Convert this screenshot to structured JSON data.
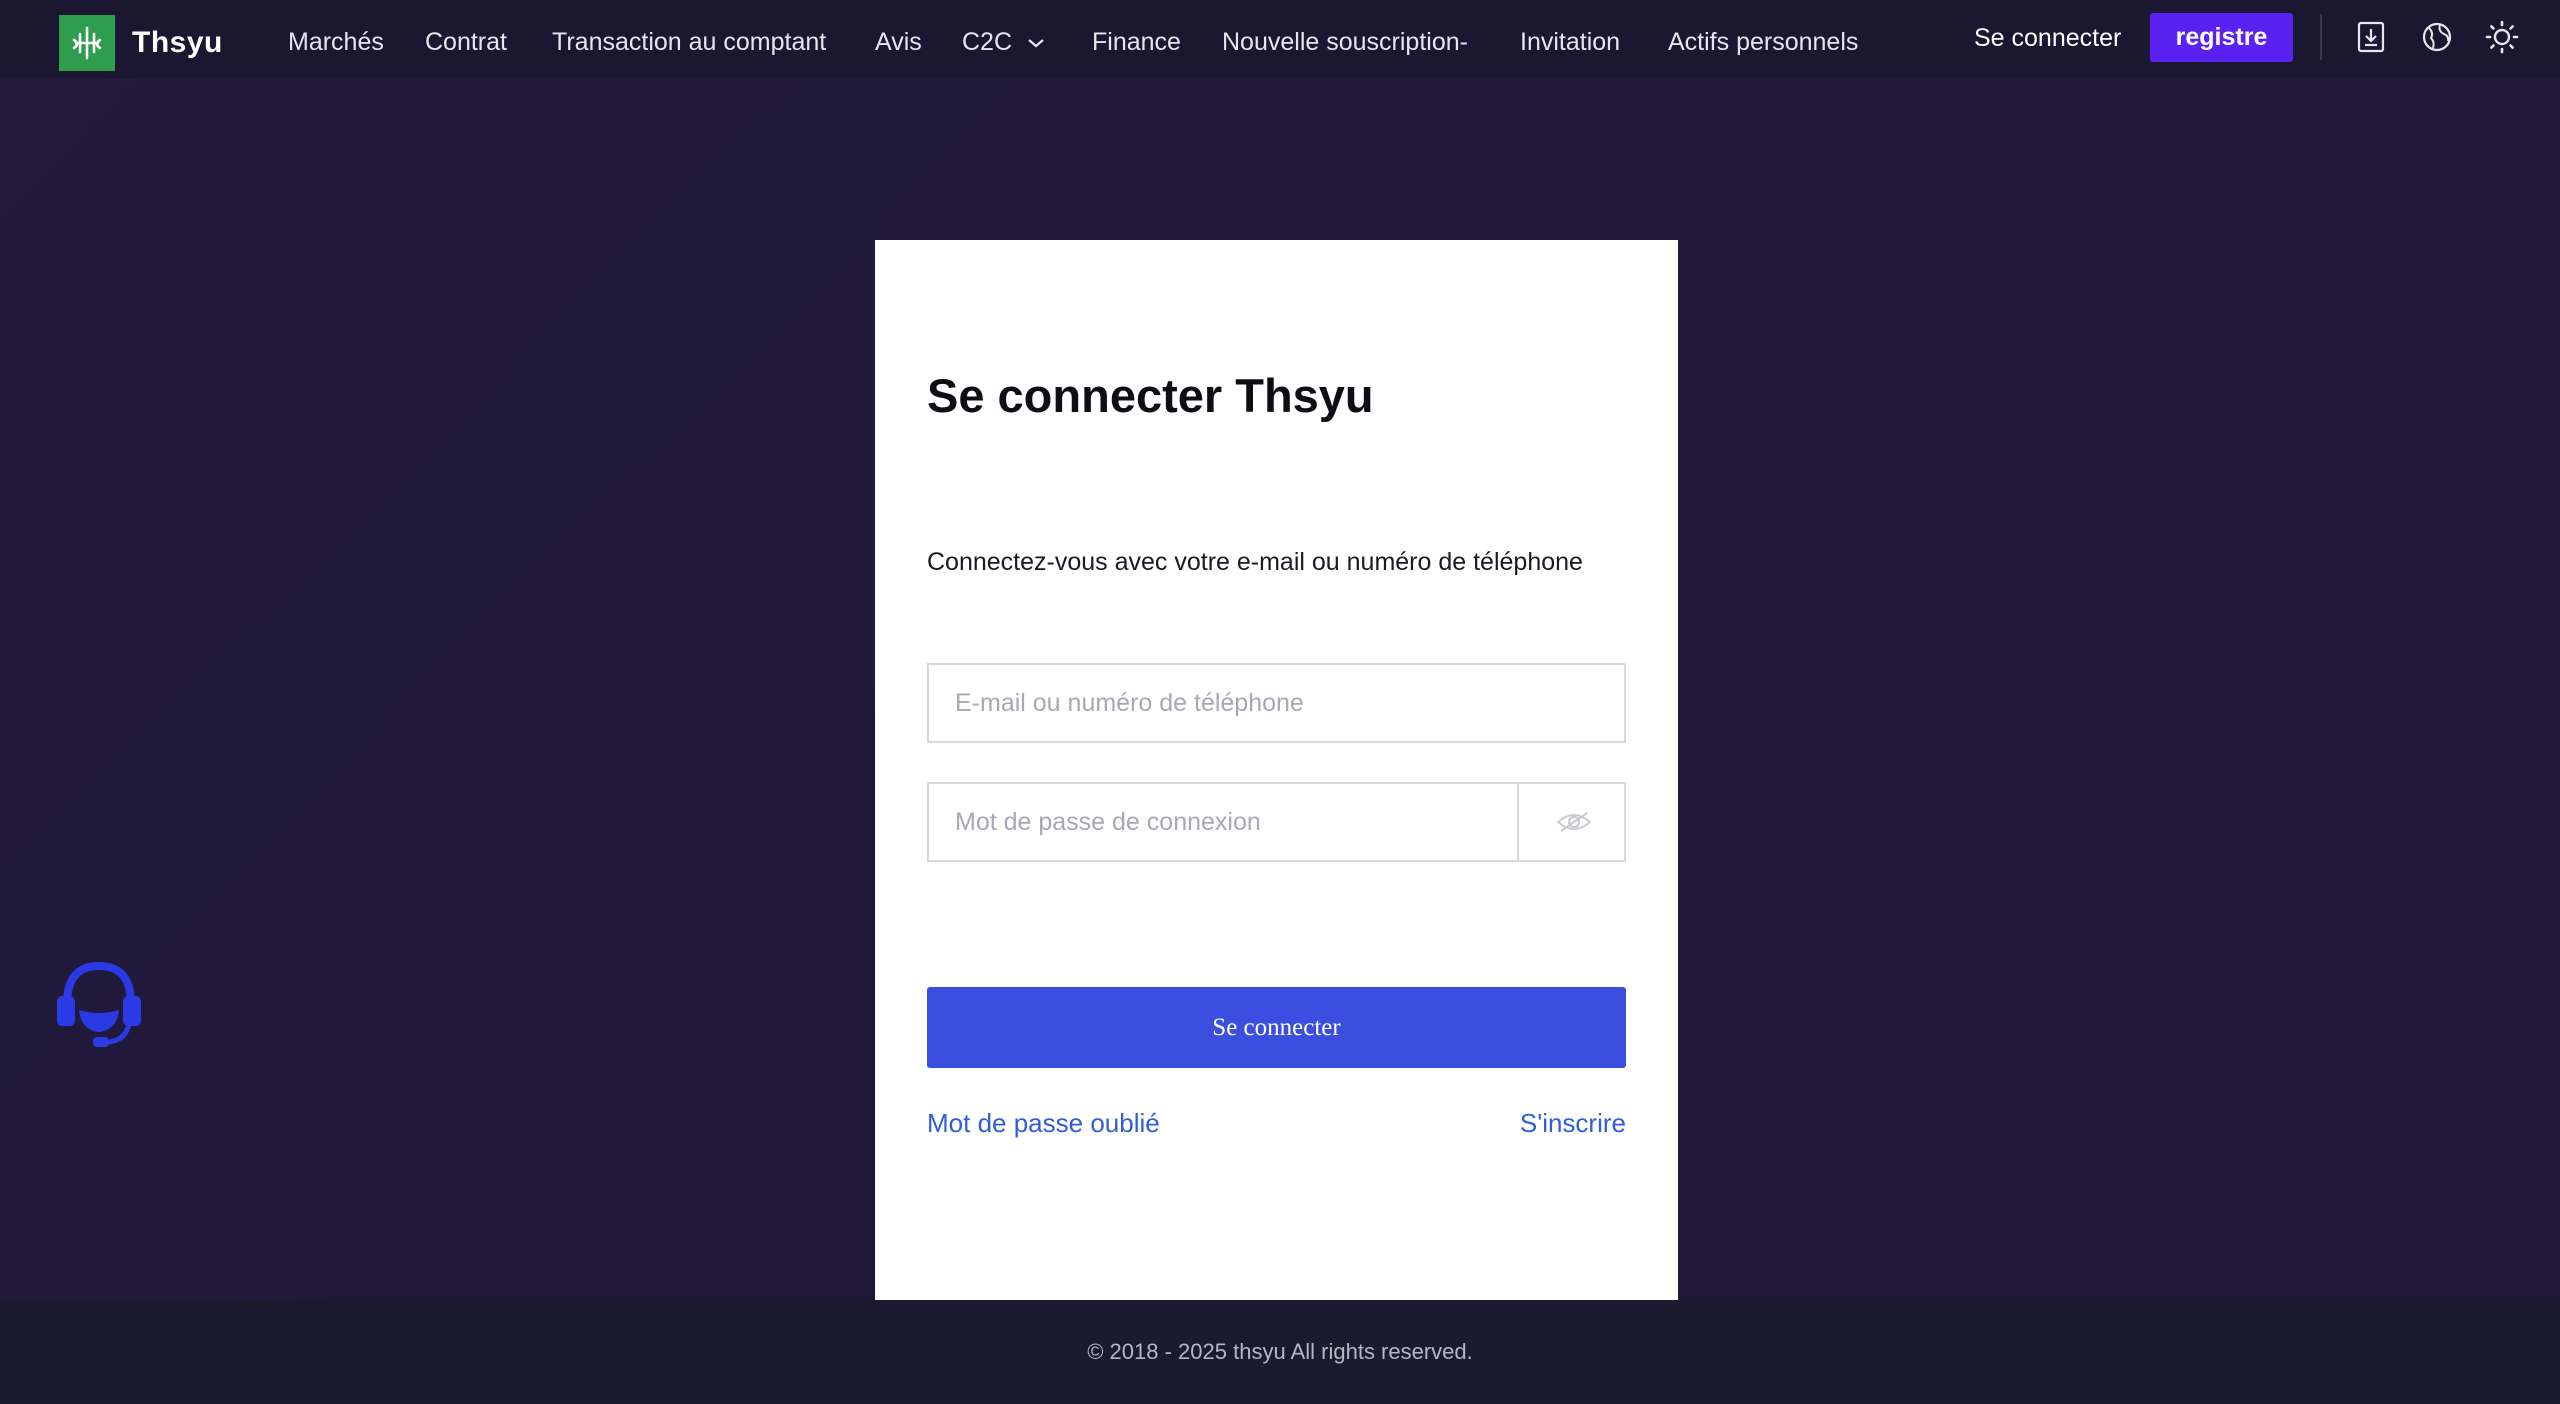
{
  "brand": {
    "name": "Thsyu"
  },
  "nav": {
    "items": [
      {
        "label": "Marchés"
      },
      {
        "label": "Contrat"
      },
      {
        "label": "Transaction au comptant"
      },
      {
        "label": "Avis"
      },
      {
        "label": "C2C"
      },
      {
        "label": "Finance"
      },
      {
        "label": "Nouvelle souscription-"
      },
      {
        "label": "Invitation"
      },
      {
        "label": "Actifs personnels"
      }
    ],
    "login_label": "Se connecter",
    "register_label": "registre",
    "icons": [
      "download-icon",
      "globe-icon",
      "sun-icon"
    ]
  },
  "login": {
    "title": "Se connecter Thsyu",
    "subtitle": "Connectez-vous avec votre e-mail ou numéro de téléphone",
    "email_placeholder": "E-mail ou numéro de téléphone",
    "email_value": "",
    "password_placeholder": "Mot de passe de connexion",
    "password_value": "",
    "submit_label": "Se connecter",
    "forgot_label": "Mot de passe oublié",
    "signup_label": "S'inscrire"
  },
  "footer": {
    "copyright": "© 2018 - 2025 thsyu All rights reserved."
  },
  "colors": {
    "accent": "#5b21f0",
    "submit": "#3a4fe0",
    "link": "#2f5fd6",
    "logo_bg": "#2e9d4d",
    "support": "#2a3be6"
  }
}
